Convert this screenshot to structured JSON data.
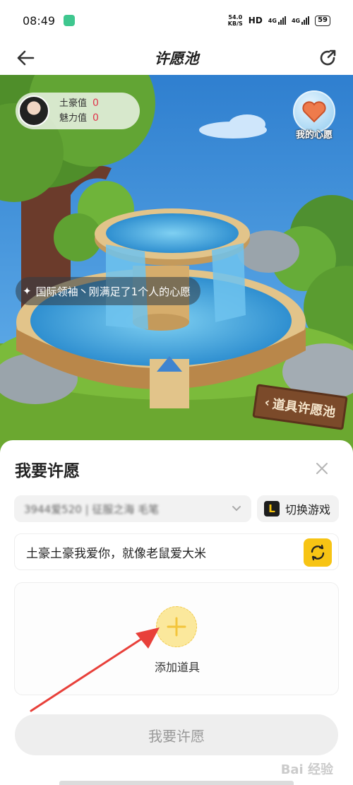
{
  "status_bar": {
    "time": "08:49",
    "net_speed_value": "54.0",
    "net_speed_unit": "KB/S",
    "hd": "HD",
    "signal_1": "4G",
    "signal_2": "4G",
    "battery": "59"
  },
  "header": {
    "title": "许愿池",
    "back_icon": "back-arrow-icon",
    "share_icon": "share-icon"
  },
  "scene": {
    "user": {
      "tuhao_label": "土豪值",
      "tuhao_value": "0",
      "charm_label": "魅力值",
      "charm_value": "0"
    },
    "my_wish_label": "我的心愿",
    "ticker_text": "国际领袖丶刚满足了1个人的心愿",
    "props_sign": "道具许愿池"
  },
  "sheet": {
    "title": "我要许愿",
    "game_select_value": "3944爱520 | 征服之海 毛笔",
    "switch_game_label": "切换游戏",
    "game_logo_letter": "L",
    "wish_text": "土豪土豪我爱你，就像老鼠爱大米",
    "add_prop_label": "添加道具",
    "submit_label": "我要许愿",
    "watermark": "Bai 经验"
  },
  "colors": {
    "accent_yellow": "#f7c414",
    "value_red": "#e0344b",
    "annotation_red": "#e8403a",
    "sky_blue": "#3f8fd8",
    "grass_green": "#6ba830"
  }
}
